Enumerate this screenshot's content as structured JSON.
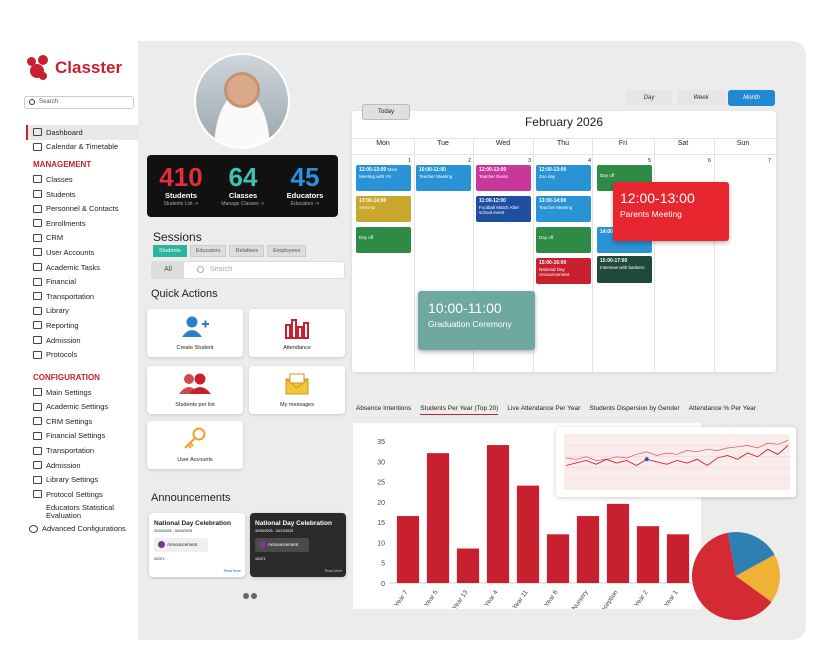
{
  "brand": {
    "name": "Classter",
    "color": "#c8202f"
  },
  "search": {
    "placeholder": "Search"
  },
  "nav": {
    "dashboard": "Dashboard",
    "calendar": "Calendar & Timetable",
    "management_heading": "MANAGEMENT",
    "management": [
      "Classes",
      "Students",
      "Personnel & Contacts",
      "Enrollments",
      "CRM",
      "User Accounts",
      "Academic Tasks",
      "Financial",
      "Transportation",
      "Library",
      "Reporting",
      "Admission",
      "Protocols"
    ],
    "configuration_heading": "CONFIGURATION",
    "configuration": [
      "Main Settings",
      "Academic Settings",
      "CRM Settings",
      "Financial Settings",
      "Transportation",
      "Admission",
      "Library Settings",
      "Protocol Settings",
      "Educators Statistical Evaluation",
      "Advanced Configurations"
    ]
  },
  "stats": [
    {
      "value": "410",
      "label": "Students",
      "sub": "Students List ->",
      "color": "#e0303a"
    },
    {
      "value": "64",
      "label": "Classes",
      "sub": "Manage Classes ->",
      "color": "#3ec3b0"
    },
    {
      "value": "45",
      "label": "Educators",
      "sub": "Educators ->",
      "color": "#2b8fe0"
    }
  ],
  "sessions": {
    "title": "Sessions",
    "tabs": [
      "Students",
      "Educators",
      "Relatives",
      "Employees"
    ],
    "filter": "All",
    "search_placeholder": "Search"
  },
  "quick_actions": {
    "title": "Quick Actions",
    "items": [
      "Create Student",
      "Attendance",
      "Students per list",
      "My messages",
      "User Accounts"
    ]
  },
  "announcements": {
    "title": "Announcements",
    "items": [
      {
        "title": "National Day Celebration",
        "dates": "30/09/2025 - 30/09/2025",
        "tag": "Announcement",
        "views": "40/371",
        "more": "Read More"
      },
      {
        "title": "National Day Celebration",
        "dates": "30/09/2025 - 30/10/2025",
        "tag": "Announcement",
        "views": "40/371",
        "more": "Read More"
      }
    ]
  },
  "calendar": {
    "views": [
      "Day",
      "Week",
      "Month"
    ],
    "active_view": "Month",
    "today": "Today",
    "title": "February 2026",
    "days": [
      "Mon",
      "Tue",
      "Wed",
      "Thu",
      "Fri",
      "Sat",
      "Sun"
    ],
    "dates": [
      "1",
      "2",
      "3",
      "4",
      "5",
      "6",
      "7"
    ],
    "events": [
      {
        "time": "12:00-13:00",
        "title": "Main Meeting with Y6",
        "color": "#2a93d5"
      },
      {
        "time": "13:00-14:00",
        "title": "Seminar",
        "color": "#c9a62c"
      },
      {
        "time": "",
        "title": "Day off",
        "color": "#2e8b45"
      },
      {
        "time": "10:00-11:00",
        "title": "Teacher Meeting",
        "color": "#2a93d5"
      },
      {
        "time": "12:00-13:00",
        "title": "Teacher Event",
        "color": "#c8389a"
      },
      {
        "time": "11:00-12:00",
        "title": "Football Match After school event",
        "color": "#1f4fa0"
      },
      {
        "time": "12:00-13:00",
        "title": "Zoo day",
        "color": "#2a93d5"
      },
      {
        "time": "13:00-14:00",
        "title": "Teacher Meeting",
        "color": "#2a93d5"
      },
      {
        "time": "",
        "title": "Day off",
        "color": "#2e8b45"
      },
      {
        "time": "15:00-16:00",
        "title": "National Day Announcement",
        "color": "#c8202f"
      },
      {
        "time": "",
        "title": "Day off",
        "color": "#2e8b45"
      },
      {
        "time": "14:00",
        "title": "",
        "color": "#2a93d5"
      },
      {
        "time": "15:00-17:00",
        "title": "Interview with bankers",
        "color": "#1f4a3a"
      }
    ],
    "popups": [
      {
        "time": "12:00-13:00",
        "title": "Parents Meeting",
        "color": "#e8262f"
      },
      {
        "time": "10:00-11:00",
        "title": "Graduation Ceremony",
        "color": "#6fa8a0"
      }
    ]
  },
  "chart_tabs": [
    "Absence Intentions",
    "Students Per Year (Top 20)",
    "Live Attendance Per Year",
    "Students Dispersion by Gender",
    "Attendance % Per Year"
  ],
  "active_chart_tab": "Students Per Year (Top 20)",
  "chart_data": [
    {
      "type": "bar",
      "categories": [
        "Year 7",
        "Year 5",
        "Year 13",
        "Year 4",
        "Year 11",
        "Year 8",
        "Nursery",
        "Reception",
        "Year 2",
        "Year 1"
      ],
      "values": [
        16.5,
        32,
        8.5,
        34,
        24,
        12,
        16.5,
        19.5,
        14,
        12
      ],
      "yticks": [
        "0",
        "5",
        "10",
        "15",
        "20",
        "25",
        "30",
        "35"
      ],
      "ylim": [
        0,
        35
      ],
      "color": "#c8202f"
    },
    {
      "type": "line",
      "series": [
        {
          "values": [
            22,
            24,
            26,
            23,
            27,
            24,
            26,
            22,
            27,
            25,
            23,
            26,
            24,
            27,
            22,
            28,
            30,
            27,
            32,
            29,
            35,
            31,
            38
          ]
        },
        {
          "values": [
            28,
            27,
            29,
            26,
            27,
            29,
            28,
            31,
            33,
            30,
            32,
            31,
            34,
            33,
            35,
            34,
            36,
            37,
            38,
            36,
            40,
            39,
            42
          ]
        }
      ],
      "color": "#c8202f"
    },
    {
      "type": "pie",
      "values": [
        62,
        20,
        18
      ],
      "colors": [
        "#d32a33",
        "#2f7fb5",
        "#f0b234"
      ]
    }
  ]
}
